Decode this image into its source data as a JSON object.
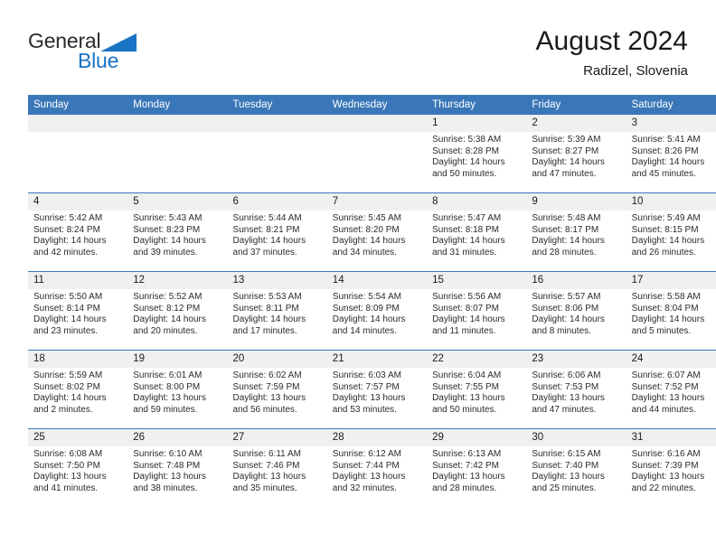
{
  "brand": {
    "name_part1": "General",
    "name_part2": "Blue",
    "accent_color": "#1a73c4"
  },
  "header": {
    "title": "August 2024",
    "location": "Radizel, Slovenia"
  },
  "weekday_headers": [
    "Sunday",
    "Monday",
    "Tuesday",
    "Wednesday",
    "Thursday",
    "Friday",
    "Saturday"
  ],
  "labels": {
    "sunrise_prefix": "Sunrise: ",
    "sunset_prefix": "Sunset: ",
    "daylight_prefix": "Daylight: "
  },
  "weeks": [
    [
      {
        "day": "",
        "empty": true
      },
      {
        "day": "",
        "empty": true
      },
      {
        "day": "",
        "empty": true
      },
      {
        "day": "",
        "empty": true
      },
      {
        "day": "1",
        "sunrise": "Sunrise: 5:38 AM",
        "sunset": "Sunset: 8:28 PM",
        "daylight_line1": "Daylight: 14 hours",
        "daylight_line2": "and 50 minutes."
      },
      {
        "day": "2",
        "sunrise": "Sunrise: 5:39 AM",
        "sunset": "Sunset: 8:27 PM",
        "daylight_line1": "Daylight: 14 hours",
        "daylight_line2": "and 47 minutes."
      },
      {
        "day": "3",
        "sunrise": "Sunrise: 5:41 AM",
        "sunset": "Sunset: 8:26 PM",
        "daylight_line1": "Daylight: 14 hours",
        "daylight_line2": "and 45 minutes."
      }
    ],
    [
      {
        "day": "4",
        "sunrise": "Sunrise: 5:42 AM",
        "sunset": "Sunset: 8:24 PM",
        "daylight_line1": "Daylight: 14 hours",
        "daylight_line2": "and 42 minutes."
      },
      {
        "day": "5",
        "sunrise": "Sunrise: 5:43 AM",
        "sunset": "Sunset: 8:23 PM",
        "daylight_line1": "Daylight: 14 hours",
        "daylight_line2": "and 39 minutes."
      },
      {
        "day": "6",
        "sunrise": "Sunrise: 5:44 AM",
        "sunset": "Sunset: 8:21 PM",
        "daylight_line1": "Daylight: 14 hours",
        "daylight_line2": "and 37 minutes."
      },
      {
        "day": "7",
        "sunrise": "Sunrise: 5:45 AM",
        "sunset": "Sunset: 8:20 PM",
        "daylight_line1": "Daylight: 14 hours",
        "daylight_line2": "and 34 minutes."
      },
      {
        "day": "8",
        "sunrise": "Sunrise: 5:47 AM",
        "sunset": "Sunset: 8:18 PM",
        "daylight_line1": "Daylight: 14 hours",
        "daylight_line2": "and 31 minutes."
      },
      {
        "day": "9",
        "sunrise": "Sunrise: 5:48 AM",
        "sunset": "Sunset: 8:17 PM",
        "daylight_line1": "Daylight: 14 hours",
        "daylight_line2": "and 28 minutes."
      },
      {
        "day": "10",
        "sunrise": "Sunrise: 5:49 AM",
        "sunset": "Sunset: 8:15 PM",
        "daylight_line1": "Daylight: 14 hours",
        "daylight_line2": "and 26 minutes."
      }
    ],
    [
      {
        "day": "11",
        "sunrise": "Sunrise: 5:50 AM",
        "sunset": "Sunset: 8:14 PM",
        "daylight_line1": "Daylight: 14 hours",
        "daylight_line2": "and 23 minutes."
      },
      {
        "day": "12",
        "sunrise": "Sunrise: 5:52 AM",
        "sunset": "Sunset: 8:12 PM",
        "daylight_line1": "Daylight: 14 hours",
        "daylight_line2": "and 20 minutes."
      },
      {
        "day": "13",
        "sunrise": "Sunrise: 5:53 AM",
        "sunset": "Sunset: 8:11 PM",
        "daylight_line1": "Daylight: 14 hours",
        "daylight_line2": "and 17 minutes."
      },
      {
        "day": "14",
        "sunrise": "Sunrise: 5:54 AM",
        "sunset": "Sunset: 8:09 PM",
        "daylight_line1": "Daylight: 14 hours",
        "daylight_line2": "and 14 minutes."
      },
      {
        "day": "15",
        "sunrise": "Sunrise: 5:56 AM",
        "sunset": "Sunset: 8:07 PM",
        "daylight_line1": "Daylight: 14 hours",
        "daylight_line2": "and 11 minutes."
      },
      {
        "day": "16",
        "sunrise": "Sunrise: 5:57 AM",
        "sunset": "Sunset: 8:06 PM",
        "daylight_line1": "Daylight: 14 hours",
        "daylight_line2": "and 8 minutes."
      },
      {
        "day": "17",
        "sunrise": "Sunrise: 5:58 AM",
        "sunset": "Sunset: 8:04 PM",
        "daylight_line1": "Daylight: 14 hours",
        "daylight_line2": "and 5 minutes."
      }
    ],
    [
      {
        "day": "18",
        "sunrise": "Sunrise: 5:59 AM",
        "sunset": "Sunset: 8:02 PM",
        "daylight_line1": "Daylight: 14 hours",
        "daylight_line2": "and 2 minutes."
      },
      {
        "day": "19",
        "sunrise": "Sunrise: 6:01 AM",
        "sunset": "Sunset: 8:00 PM",
        "daylight_line1": "Daylight: 13 hours",
        "daylight_line2": "and 59 minutes."
      },
      {
        "day": "20",
        "sunrise": "Sunrise: 6:02 AM",
        "sunset": "Sunset: 7:59 PM",
        "daylight_line1": "Daylight: 13 hours",
        "daylight_line2": "and 56 minutes."
      },
      {
        "day": "21",
        "sunrise": "Sunrise: 6:03 AM",
        "sunset": "Sunset: 7:57 PM",
        "daylight_line1": "Daylight: 13 hours",
        "daylight_line2": "and 53 minutes."
      },
      {
        "day": "22",
        "sunrise": "Sunrise: 6:04 AM",
        "sunset": "Sunset: 7:55 PM",
        "daylight_line1": "Daylight: 13 hours",
        "daylight_line2": "and 50 minutes."
      },
      {
        "day": "23",
        "sunrise": "Sunrise: 6:06 AM",
        "sunset": "Sunset: 7:53 PM",
        "daylight_line1": "Daylight: 13 hours",
        "daylight_line2": "and 47 minutes."
      },
      {
        "day": "24",
        "sunrise": "Sunrise: 6:07 AM",
        "sunset": "Sunset: 7:52 PM",
        "daylight_line1": "Daylight: 13 hours",
        "daylight_line2": "and 44 minutes."
      }
    ],
    [
      {
        "day": "25",
        "sunrise": "Sunrise: 6:08 AM",
        "sunset": "Sunset: 7:50 PM",
        "daylight_line1": "Daylight: 13 hours",
        "daylight_line2": "and 41 minutes."
      },
      {
        "day": "26",
        "sunrise": "Sunrise: 6:10 AM",
        "sunset": "Sunset: 7:48 PM",
        "daylight_line1": "Daylight: 13 hours",
        "daylight_line2": "and 38 minutes."
      },
      {
        "day": "27",
        "sunrise": "Sunrise: 6:11 AM",
        "sunset": "Sunset: 7:46 PM",
        "daylight_line1": "Daylight: 13 hours",
        "daylight_line2": "and 35 minutes."
      },
      {
        "day": "28",
        "sunrise": "Sunrise: 6:12 AM",
        "sunset": "Sunset: 7:44 PM",
        "daylight_line1": "Daylight: 13 hours",
        "daylight_line2": "and 32 minutes."
      },
      {
        "day": "29",
        "sunrise": "Sunrise: 6:13 AM",
        "sunset": "Sunset: 7:42 PM",
        "daylight_line1": "Daylight: 13 hours",
        "daylight_line2": "and 28 minutes."
      },
      {
        "day": "30",
        "sunrise": "Sunrise: 6:15 AM",
        "sunset": "Sunset: 7:40 PM",
        "daylight_line1": "Daylight: 13 hours",
        "daylight_line2": "and 25 minutes."
      },
      {
        "day": "31",
        "sunrise": "Sunrise: 6:16 AM",
        "sunset": "Sunset: 7:39 PM",
        "daylight_line1": "Daylight: 13 hours",
        "daylight_line2": "and 22 minutes."
      }
    ]
  ]
}
